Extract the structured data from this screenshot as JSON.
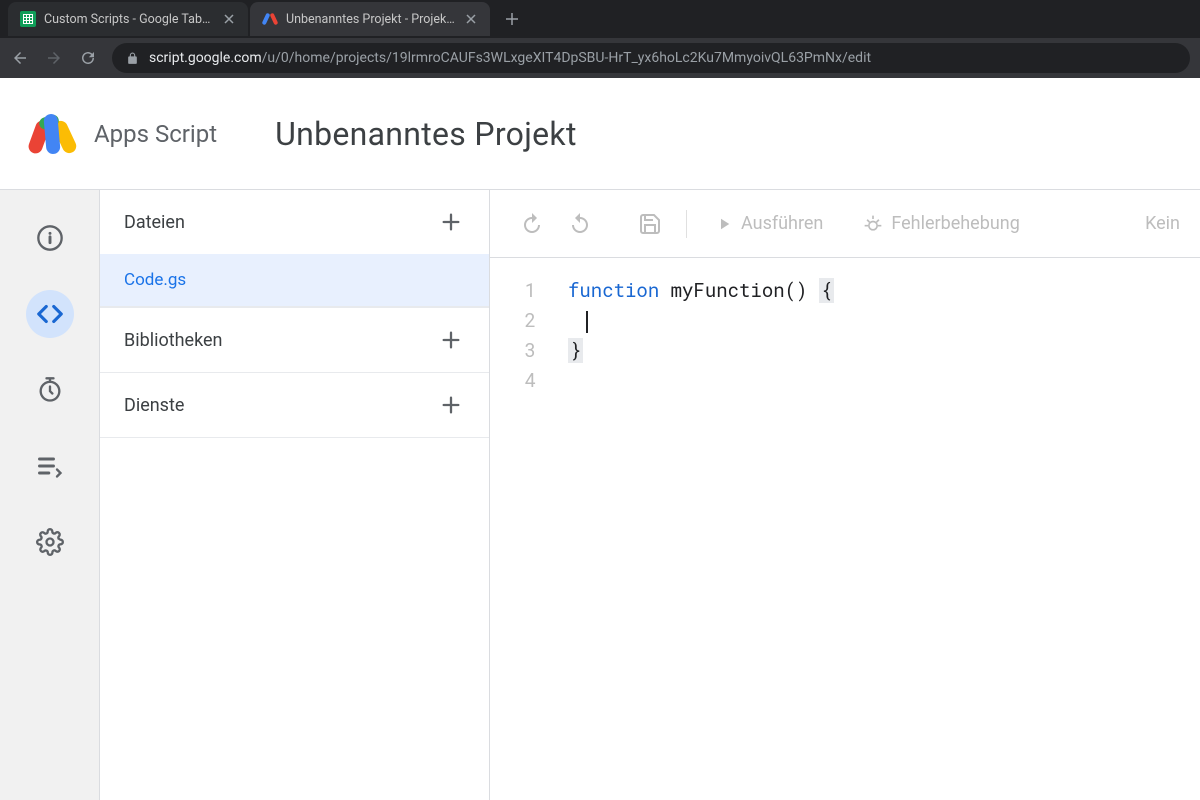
{
  "browser": {
    "tabs": [
      {
        "title": "Custom Scripts - Google Tabellen",
        "active": false
      },
      {
        "title": "Unbenanntes Projekt - Projekt-E",
        "active": true
      }
    ],
    "url_host": "script.google.com",
    "url_path": "/u/0/home/projects/19lrmroCAUFs3WLxgeXIT4DpSBU-HrT_yx6hoLc2Ku7MmyoivQL63PmNx/edit"
  },
  "header": {
    "app_name": "Apps Script",
    "project_title": "Unbenanntes Projekt"
  },
  "side_panel": {
    "files_label": "Dateien",
    "file_name": "Code.gs",
    "libs_label": "Bibliotheken",
    "services_label": "Dienste"
  },
  "toolbar": {
    "run_label": "Ausführen",
    "debug_label": "Fehlerbehebung",
    "trail_label": "Kein"
  },
  "code": {
    "lines": [
      "1",
      "2",
      "3",
      "4"
    ],
    "keyword": "function",
    "fn": " myFunction() ",
    "brace_open": "{",
    "brace_close": "}"
  }
}
